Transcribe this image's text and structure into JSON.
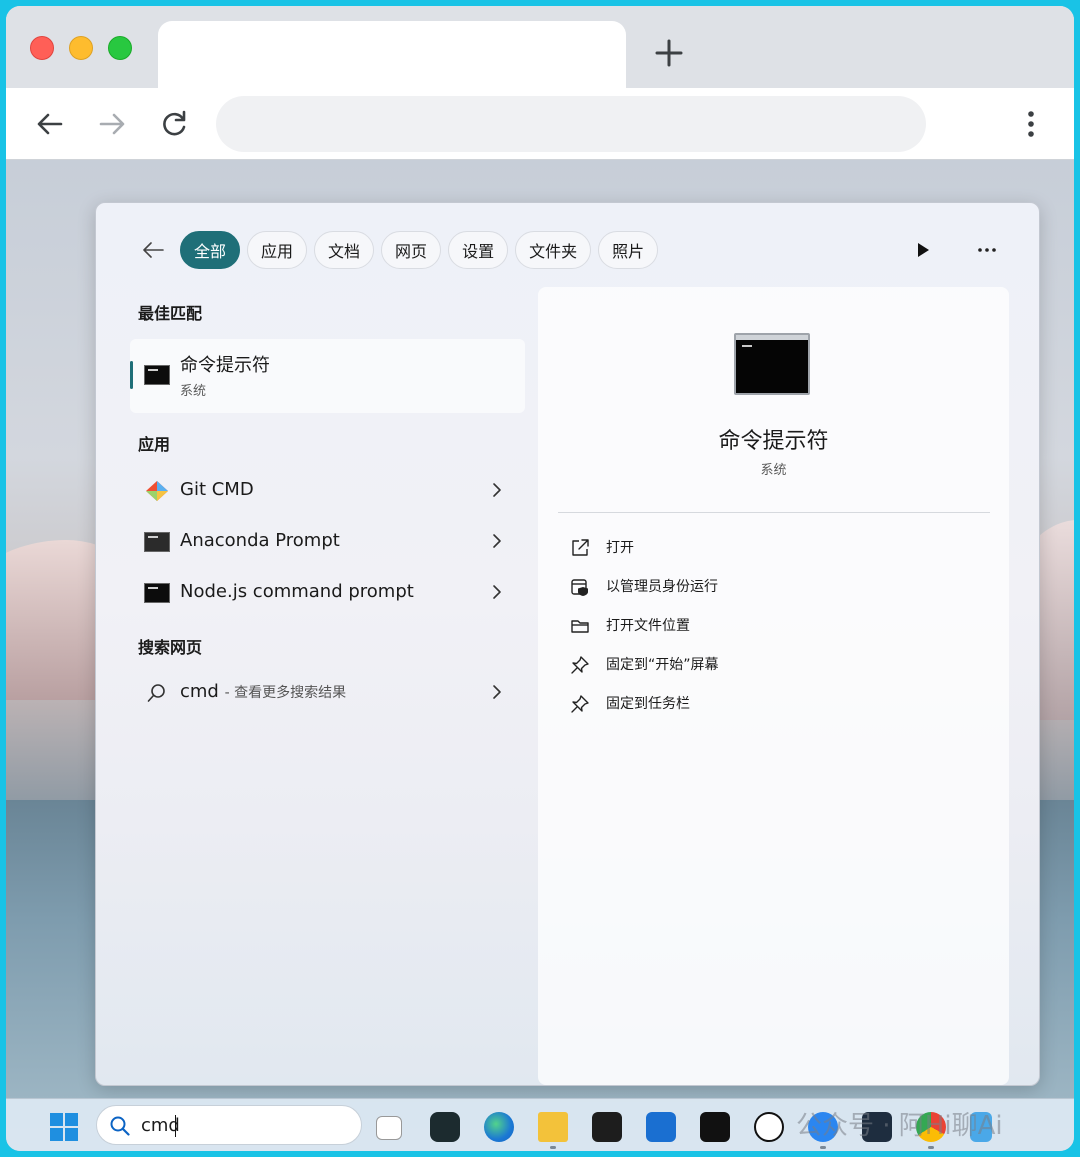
{
  "panel": {
    "filters": [
      "全部",
      "应用",
      "文档",
      "网页",
      "设置",
      "文件夹",
      "照片"
    ],
    "active_filter": "全部",
    "best_match_heading": "最佳匹配",
    "best_match": {
      "title": "命令提示符",
      "subtitle": "系统"
    },
    "apps_heading": "应用",
    "apps": [
      "Git CMD",
      "Anaconda Prompt",
      "Node.js command prompt"
    ],
    "web_heading": "搜索网页",
    "web_query": "cmd",
    "web_hint": "- 查看更多搜索结果"
  },
  "detail": {
    "title": "命令提示符",
    "subtitle": "系统",
    "actions": [
      "打开",
      "以管理员身份运行",
      "打开文件位置",
      "固定到“开始”屏幕",
      "固定到任务栏"
    ]
  },
  "taskbar": {
    "search_value": "cmd",
    "watermark": "公众号 · 阿Hi聊Ai"
  },
  "colors": {
    "accent": "#1f6f78",
    "frame": "#19c3e6"
  }
}
